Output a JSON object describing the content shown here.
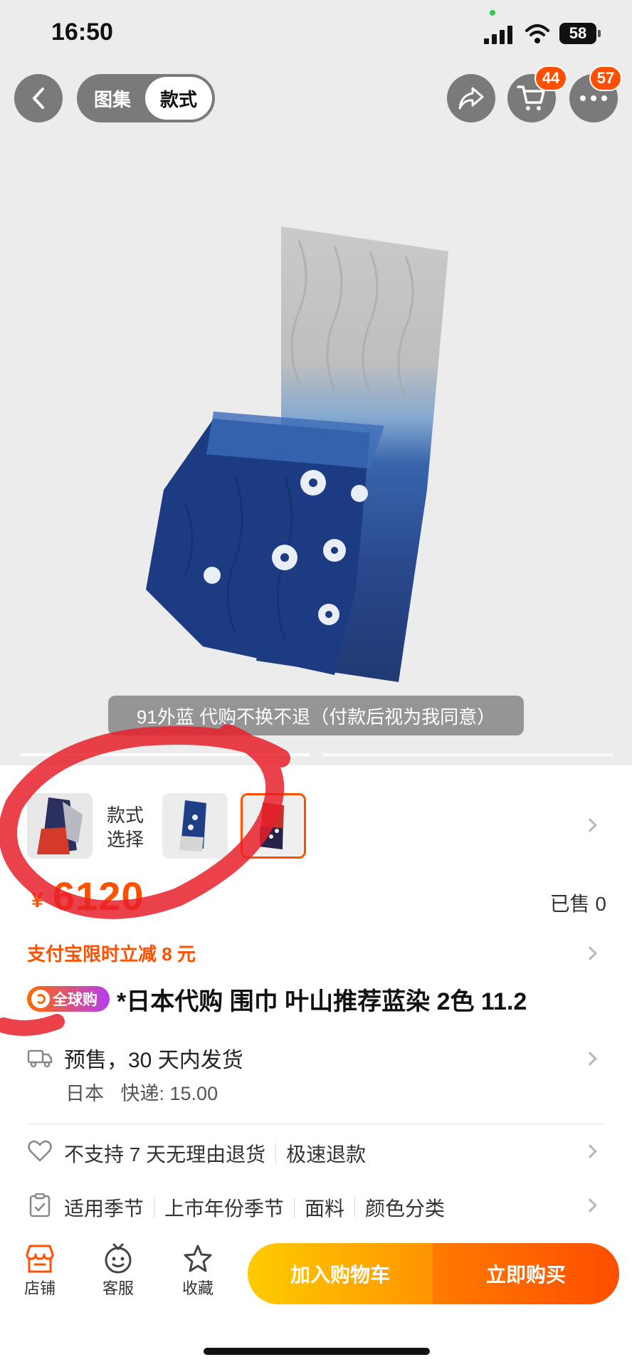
{
  "status_bar": {
    "time": "16:50",
    "battery": "58"
  },
  "nav": {
    "tabs": [
      {
        "label": "图集"
      },
      {
        "label": "款式"
      }
    ],
    "cart_badge": "44",
    "more_badge": "57"
  },
  "image": {
    "caption": "91外蓝 代购不换不退（付款后视为我同意）"
  },
  "styles": {
    "label_line1": "款式",
    "label_line2": "选择"
  },
  "price": {
    "currency": "¥",
    "value": "6120",
    "sold": "已售 0"
  },
  "promo": "支付宝限时立减 8 元",
  "title": {
    "badge": "全球购",
    "text": "*日本代购 围巾 叶山推荐蓝染 2色 11.2"
  },
  "shipping": {
    "main": "预售，30 天内发货",
    "origin": "日本",
    "fee": "快递: 15.00"
  },
  "returns": {
    "items": [
      "不支持 7 天无理由退货",
      "极速退款"
    ]
  },
  "attributes": {
    "items": [
      "适用季节",
      "上市年份季节",
      "面料",
      "颜色分类"
    ]
  },
  "bottom_bar": {
    "shop": "店铺",
    "service": "客服",
    "favorite": "收藏",
    "add_to_cart": "加入购物车",
    "buy_now": "立即购买"
  },
  "colors": {
    "accent": "#ff5000",
    "cart_button": "#ffb300",
    "buy_button": "#ff5a00",
    "annotation": "#e8202a"
  }
}
